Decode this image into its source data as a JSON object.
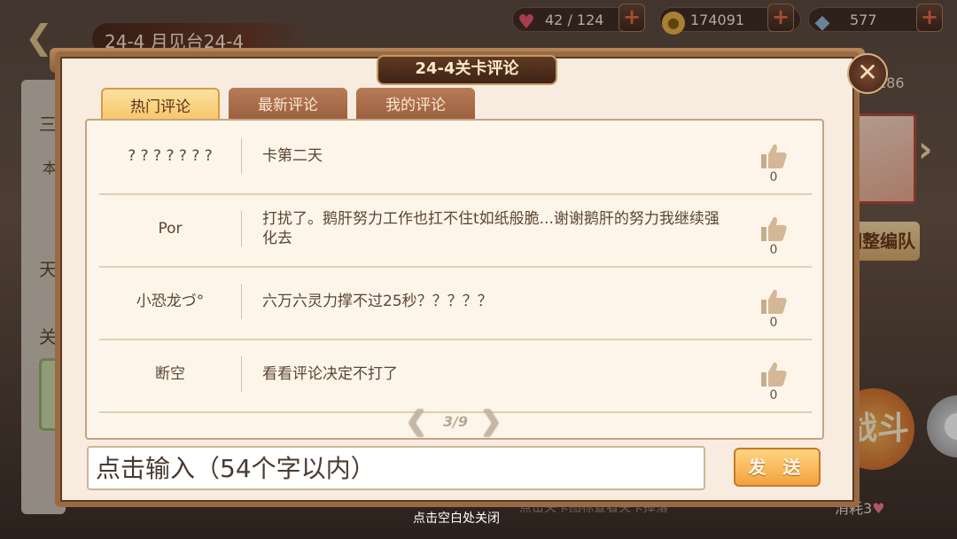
{
  "top_bar": {
    "stage_title": "24-4 月见台24-4",
    "resources": [
      {
        "name": "stamina",
        "value": "42 / 124",
        "icon": "heart-icon",
        "color": "#e8546a"
      },
      {
        "name": "gold",
        "value": "174091",
        "icon": "coin-icon",
        "color": "#e5b24a"
      },
      {
        "name": "crystal",
        "value": "577",
        "icon": "crystal-icon",
        "color": "#8fb7d8"
      }
    ]
  },
  "background": {
    "left_char_1": "三",
    "left_char_2": "本",
    "left_char_3": "天",
    "left_char_4": "关",
    "right_count": "186",
    "right_banner": "调整编队",
    "right_fight": "战斗",
    "right_cost": "消耗3",
    "bottom_hint": "点击关卡图标查看关卡掉落"
  },
  "dialog": {
    "title": "24-4关卡评论",
    "tabs": [
      {
        "label": "热门评论",
        "active": true
      },
      {
        "label": "最新评论",
        "active": false
      },
      {
        "label": "我的评论",
        "active": false
      }
    ],
    "comments": [
      {
        "user": "? ? ? ? ? ? ?",
        "text": "卡第二天",
        "likes": "0"
      },
      {
        "user": "Por",
        "text": "打扰了。鹅肝努力工作也扛不住t如纸般脆...谢谢鹅肝的努力我继续强化去",
        "likes": "0"
      },
      {
        "user": "小恐龙づ°",
        "text": "六万六灵力撑不过25秒？？？？？",
        "likes": "0"
      },
      {
        "user": "断空",
        "text": "看看评论决定不打了",
        "likes": "0"
      }
    ],
    "pager": {
      "text": "3/9"
    },
    "input": {
      "placeholder": "点击输入（54个字以内）"
    },
    "send_label": "发 送",
    "close_hint": "点击空白处关闭"
  },
  "colors": {
    "accent": "#f3a23e",
    "dialog_border": "#9a6b43",
    "panel_bg": "#fdf5ea"
  }
}
